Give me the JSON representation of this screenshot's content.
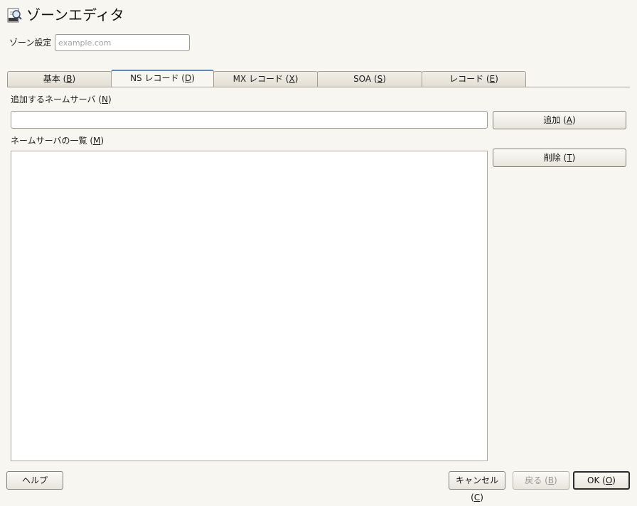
{
  "window": {
    "title": "ゾーンエディタ",
    "icon": "dns-zone-icon"
  },
  "zone": {
    "label": "ゾーン設定",
    "placeholder": "example.com",
    "value": ""
  },
  "tabs": [
    {
      "pre": "基本 (",
      "key": "B",
      "post": ")",
      "active": false
    },
    {
      "pre": "NS レコード (",
      "key": "D",
      "post": ")",
      "active": true
    },
    {
      "pre": "MX レコード (",
      "key": "X",
      "post": ")",
      "active": false
    },
    {
      "pre": "SOA (",
      "key": "S",
      "post": ")",
      "active": false
    },
    {
      "pre": "レコード (",
      "key": "E",
      "post": ")",
      "active": false
    }
  ],
  "ns": {
    "add_label": {
      "pre": "追加するネームサーバ (",
      "key": "N",
      "post": ")"
    },
    "add_value": "",
    "add_button": {
      "pre": "追加 (",
      "key": "A",
      "post": ")"
    },
    "list_label": {
      "pre": "ネームサーバの一覧 (",
      "key": "M",
      "post": ")"
    },
    "list_items": [],
    "delete_button": {
      "pre": "削除 (",
      "key": "T",
      "post": ")"
    }
  },
  "footer": {
    "help": "ヘルプ",
    "cancel": {
      "pre": "キャンセル (",
      "key": "C",
      "post": ")"
    },
    "back": {
      "pre": "戻る (",
      "key": "B",
      "post": ")"
    },
    "ok": {
      "pre": "OK (",
      "key": "O",
      "post": ")"
    }
  },
  "colors": {
    "background": "#f8f6f0",
    "active_tab_accent": "#5e8ab8"
  }
}
